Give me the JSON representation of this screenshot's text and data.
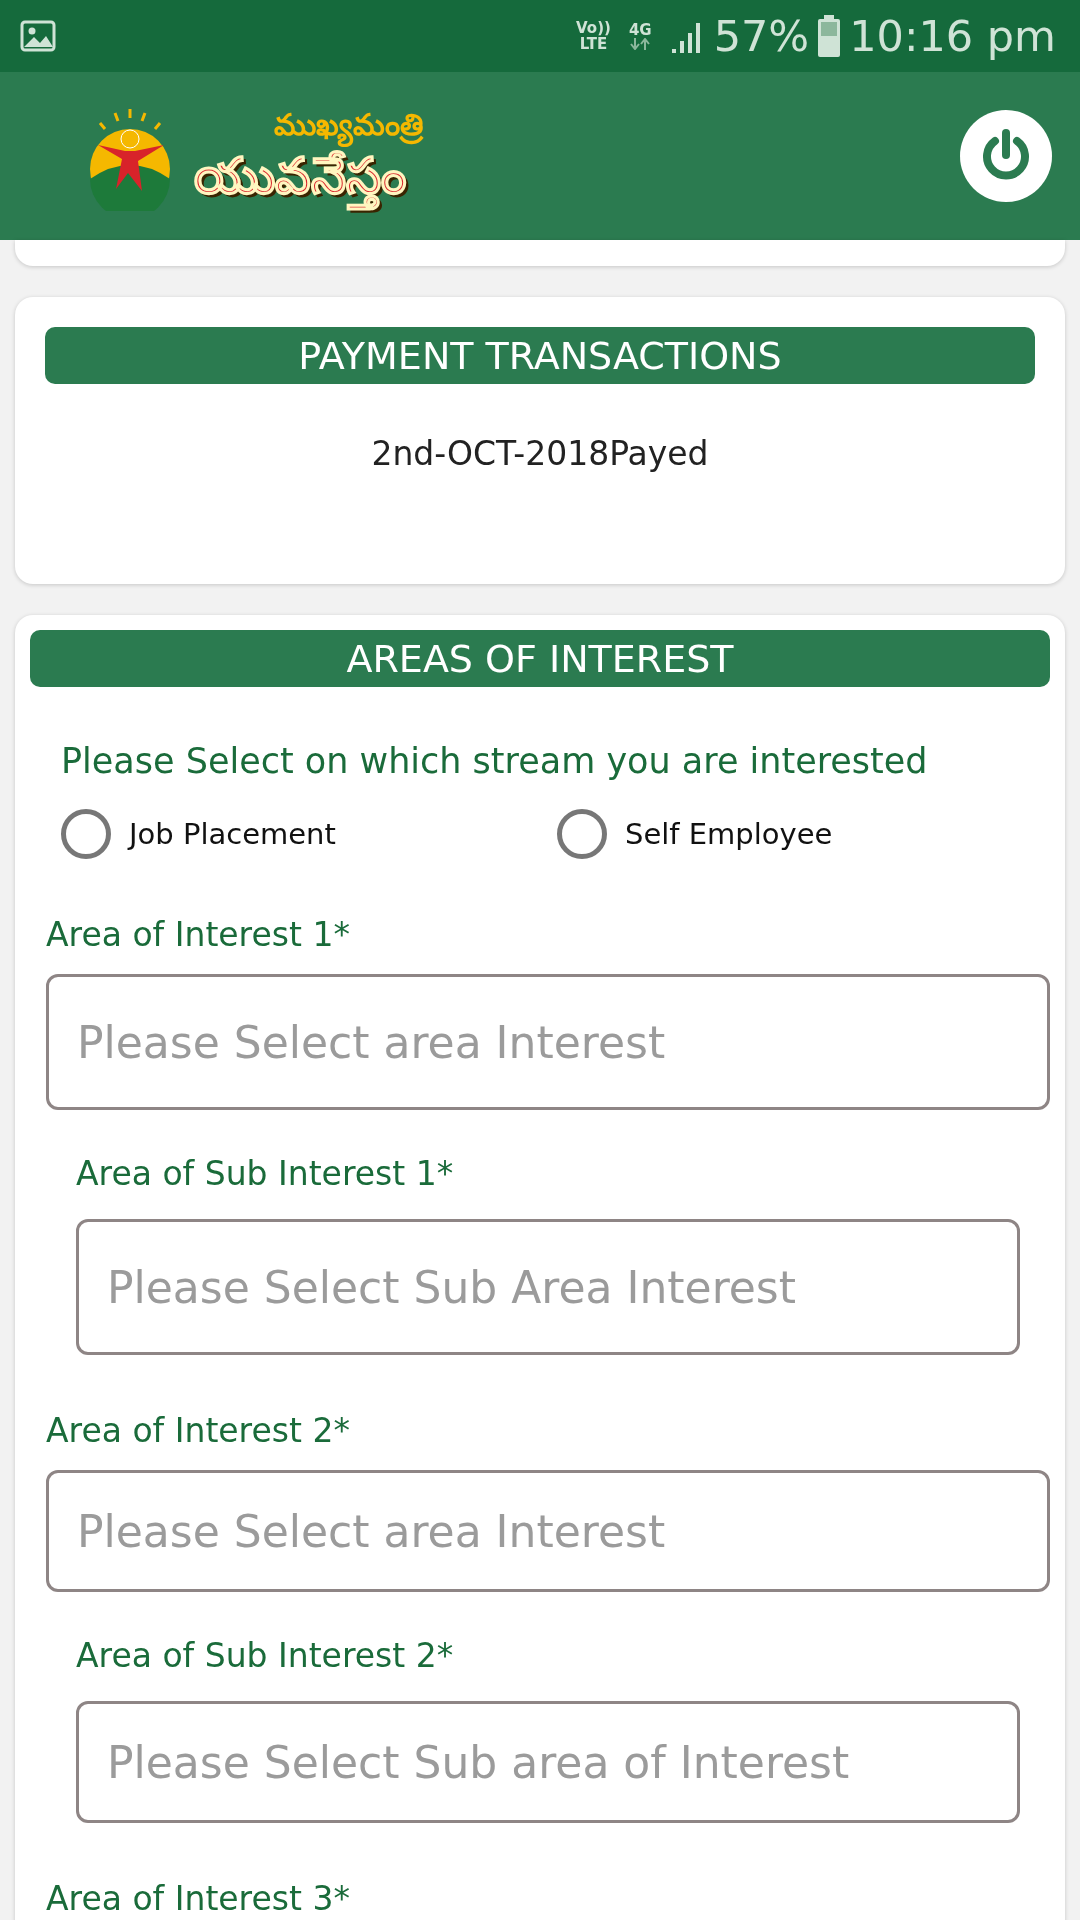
{
  "status_bar": {
    "volte_top": "Vo))",
    "volte_bottom": "LTE",
    "network": "4G",
    "battery": "57%",
    "time": "10:16 pm"
  },
  "header": {
    "logo_top": "ముఖ్యమంత్రి",
    "logo_bottom": "యువనేస్తం"
  },
  "payment": {
    "title": "PAYMENT TRANSACTIONS",
    "entries": [
      "2nd-OCT-2018Payed"
    ]
  },
  "interests": {
    "title": "AREAS OF INTEREST",
    "prompt": "Please Select on which stream you are interested",
    "options": [
      {
        "label": "Job Placement",
        "selected": false
      },
      {
        "label": "Self Employee",
        "selected": false
      }
    ],
    "fields": [
      {
        "kind": "main",
        "label": "Area of Interest 1*",
        "placeholder": "Please Select area Interest"
      },
      {
        "kind": "sub",
        "label": "Area of Sub Interest 1*",
        "placeholder": "Please Select Sub Area Interest"
      },
      {
        "kind": "main",
        "label": "Area of Interest 2*",
        "placeholder": "Please Select area Interest"
      },
      {
        "kind": "sub",
        "label": "Area of Sub Interest 2*",
        "placeholder": "Please Select Sub area of Interest"
      },
      {
        "kind": "main",
        "label": "Area of Interest 3*"
      }
    ]
  }
}
